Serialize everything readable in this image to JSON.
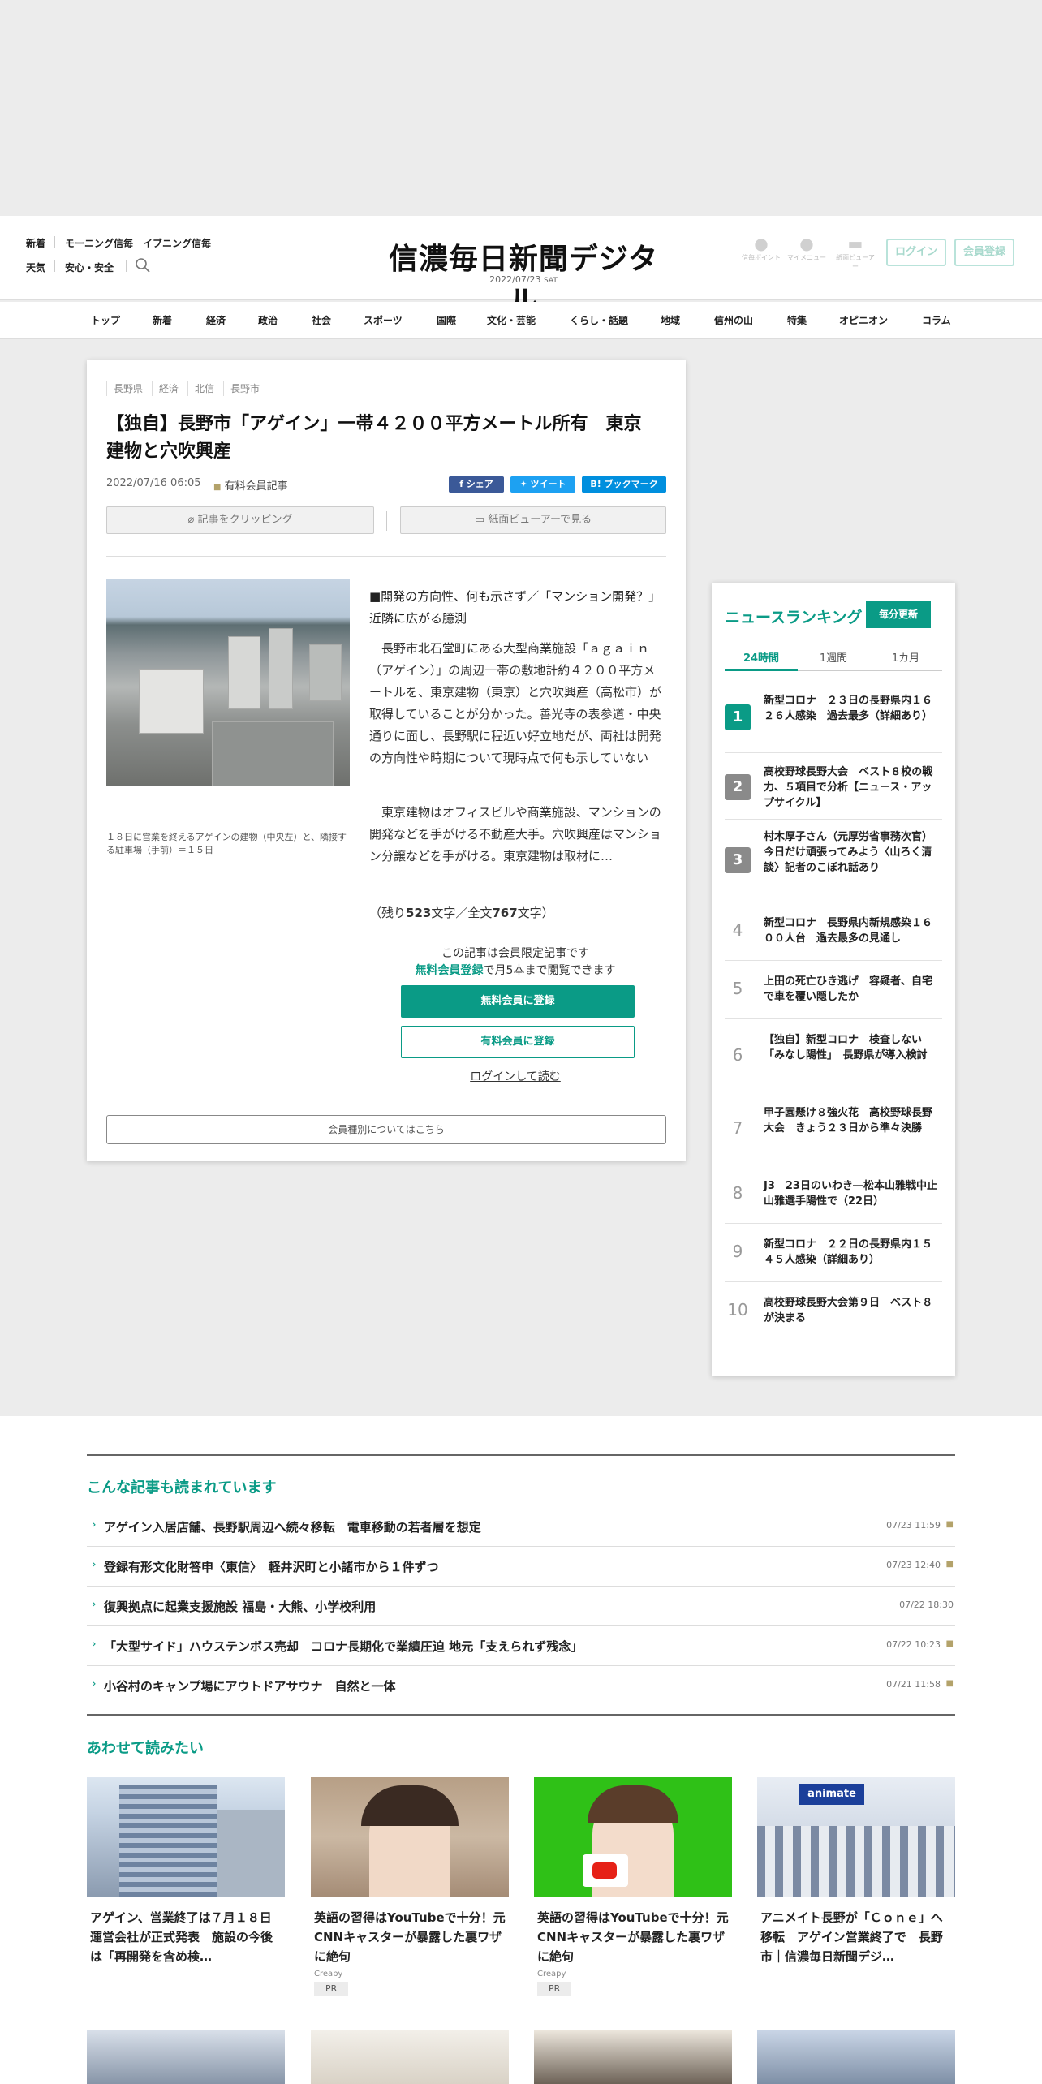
{
  "header": {
    "links_row1": [
      "新着",
      "モーニング信毎",
      "イブニング信毎"
    ],
    "links_row2": [
      "天気",
      "安心・安全"
    ],
    "search_icon": "search-icon",
    "logo_text": "信濃毎日新聞デジタル",
    "date": "2022/07/23",
    "weekday": "SAT",
    "icons": [
      {
        "label": "信毎ポイント",
        "icon": "coin-icon"
      },
      {
        "label": "マイメニュー",
        "icon": "person-icon"
      },
      {
        "label": "紙面ビューアー",
        "icon": "book-icon"
      }
    ],
    "login_label": "ログイン",
    "register_label": "会員登録"
  },
  "nav": [
    "トップ",
    "新着",
    "経済",
    "政治",
    "社会",
    "スポーツ",
    "国際",
    "文化・芸能",
    "くらし・話題",
    "地域",
    "信州の山",
    "特集",
    "オピニオン",
    "コラム"
  ],
  "article": {
    "tags": [
      "長野県",
      "経済",
      "北信",
      "長野市"
    ],
    "title": "【独自】長野市「アゲイン」一帯４２００平方メートル所有　東京建物と穴吹興産",
    "date": "2022/07/16 06:05",
    "paid_label": "有料会員記事",
    "share_buttons": [
      {
        "label": "f シェア",
        "color": "#3b5998"
      },
      {
        "label": "ツイート",
        "color": "#1da1f2"
      },
      {
        "label": "B! ブックマーク",
        "color": "#008fde"
      }
    ],
    "clip_label": "記事をクリッピング",
    "viewer_label": "紙面ビューアーで見る",
    "photo_caption": "１８日に営業を終えるアゲインの建物（中央左）と、隣接する駐車場（手前）＝１５日",
    "lead": "■開発の方向性、何も示さず／「マンション開発？」近隣に広がる臆測",
    "paragraph1": "　長野市北石堂町にある大型商業施設「ａｇａｉｎ（アゲイン）」の周辺一帯の敷地計約４２００平方メートルを、東京建物（東京）と穴吹興産（高松市）が取得していることが分かった。善光寺の表参道・中央通りに面し、長野駅に程近い好立地だが、両社は開発の方向性や時期について現時点で何も示していない",
    "paragraph2": "　東京建物はオフィスビルや商業施設、マンションの開発などを手がける不動産大手。穴吹興産はマンション分譲などを手がける。東京建物は取材に…",
    "remaining_prefix": "（残り",
    "remaining_chars": "523",
    "remaining_mid": "文字／全文",
    "total_chars": "767",
    "remaining_suffix": "文字）",
    "members_only": "この記事は会員限定記事です",
    "free_reg_link": "無料会員登録",
    "free_reg_suffix": "で月5本まで閲覧できます",
    "free_reg_button": "無料会員に登録",
    "paid_reg_button": "有料会員に登録",
    "login_read": "ログインして読む",
    "member_types": "会員種別についてはこちら"
  },
  "ranking": {
    "title": "ニュースランキング",
    "update_label": "毎分更新",
    "tabs": [
      "24時間",
      "1週間",
      "1カ月"
    ],
    "items": [
      {
        "rank": "1",
        "text": "新型コロナ　２３日の長野県内１６２６人感染　過去最多（詳細あり）"
      },
      {
        "rank": "2",
        "text": "高校野球長野大会　ベスト８校の戦力、５項目で分析【ニュース・アップサイクル】"
      },
      {
        "rank": "3",
        "text": "村木厚子さん（元厚労省事務次官）　今日だけ頑張ってみよう〈山ろく清談〉記者のこぼれ話あり"
      },
      {
        "rank": "4",
        "text": "新型コロナ　長野県内新規感染１６００人台　過去最多の見通し"
      },
      {
        "rank": "5",
        "text": "上田の死亡ひき逃げ　容疑者、自宅で車を覆い隠したか"
      },
      {
        "rank": "6",
        "text": "【独自】新型コロナ　検査しない「みなし陽性」　長野県が導入検討"
      },
      {
        "rank": "7",
        "text": "甲子園懸け８強火花　高校野球長野大会　きょう２３日から準々決勝"
      },
      {
        "rank": "8",
        "text": "J3　23日のいわき―松本山雅戦中止　山雅選手陽性で（22日）"
      },
      {
        "rank": "9",
        "text": "新型コロナ　２２日の長野県内１５４５人感染（詳細あり）"
      },
      {
        "rank": "10",
        "text": "高校野球長野大会第９日　ベスト８が決まる"
      }
    ]
  },
  "also_read": {
    "title": "こんな記事も読まれています",
    "items": [
      {
        "text": "アゲイン入居店舗、長野駅周辺へ続々移転　電車移動の若者層を想定",
        "date": "07/23 11:59",
        "locked": true
      },
      {
        "text": "登録有形文化財答申〈東信〉　軽井沢町と小諸市から１件ずつ",
        "date": "07/23 12:40",
        "locked": true
      },
      {
        "text": "復興拠点に起業支援施設 福島・大熊、小学校利用",
        "date": "07/22 18:30",
        "locked": false
      },
      {
        "text": "「大型サイド」ハウステンボス売却　コロナ長期化で業績圧迫 地元「支えられず残念」",
        "date": "07/22 10:23",
        "locked": true
      },
      {
        "text": "小谷村のキャンプ場にアウトドアサウナ　自然と一体",
        "date": "07/21 11:58",
        "locked": true
      }
    ]
  },
  "recommend": {
    "title": "あわせて読みたい",
    "cards": [
      {
        "text": "アゲイン、営業終了は７月１８日　運営会社が正式発表　施設の今後は「再開発を含め検…",
        "source": "",
        "pr": ""
      },
      {
        "text": "英語の習得はYouTubeで十分！元CNNキャスターが暴露した裏ワザに絶句",
        "source": "Creapy",
        "pr": "PR"
      },
      {
        "text": "英語の習得はYouTubeで十分！元CNNキャスターが暴露した裏ワザに絶句",
        "source": "Creapy",
        "pr": "PR"
      },
      {
        "text": "アニメイト長野が「Ｃｏｎｅ」へ移転　アゲイン営業終了で　長野市｜信濃毎日新聞デジ…",
        "source": "",
        "pr": ""
      }
    ],
    "animate_sign": "animate"
  }
}
